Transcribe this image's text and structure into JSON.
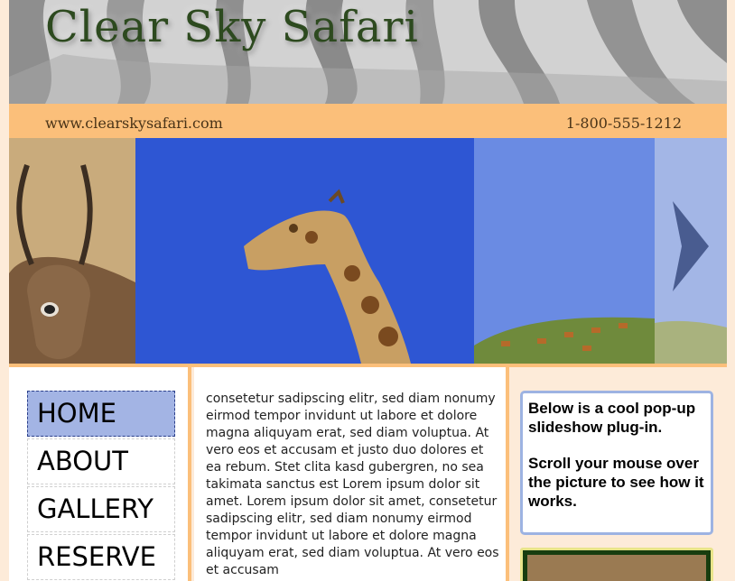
{
  "header": {
    "title": "Clear Sky Safari",
    "url": "www.clearskysafari.com",
    "phone": "1-800-555-1212"
  },
  "slideshow": {
    "next_icon": "chevron-right-icon"
  },
  "nav": {
    "items": [
      {
        "label": "HOME",
        "active": true
      },
      {
        "label": "ABOUT"
      },
      {
        "label": "GALLERY"
      },
      {
        "label": "RESERVE"
      }
    ]
  },
  "content": {
    "text": "consetetur sadipscing elitr, sed diam nonumy eirmod tempor invidunt ut labore et dolore magna aliquyam erat, sed diam voluptua. At vero eos et accusam et justo duo dolores et ea rebum. Stet clita kasd gubergren, no sea takimata sanctus est Lorem ipsum dolor sit amet. Lorem ipsum dolor sit amet, consetetur sadipscing elitr, sed diam nonumy eirmod tempor invidunt ut labore et dolore magna aliquyam erat, sed diam voluptua. At vero eos et accusam"
  },
  "sidebar": {
    "line1": "Below is a cool pop-up slideshow plug-in.",
    "line2": "Scroll your mouse over the picture to see how it works."
  },
  "colors": {
    "accent": "#fbbf7a",
    "background": "#fdebd9",
    "nav_active": "#a3b4e4",
    "title_green": "#2d4a1f"
  }
}
